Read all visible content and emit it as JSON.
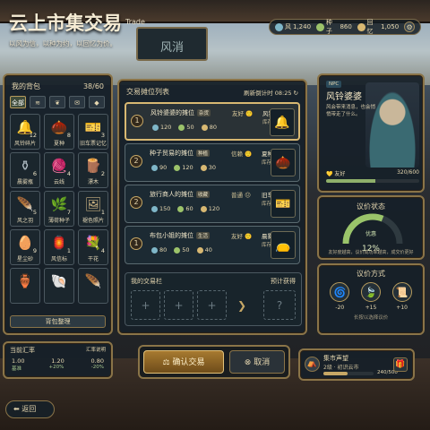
{
  "header": {
    "title": "云上市集交易",
    "title_en": "Trade",
    "subtitle": "以风为信，以种为约，以回忆为价。",
    "sign": "风消"
  },
  "resources": [
    {
      "name": "风",
      "value": "1,240",
      "color": "#7fb6c8"
    },
    {
      "name": "种子",
      "value": "860",
      "color": "#9cc36a"
    },
    {
      "name": "回忆",
      "value": "1,050",
      "color": "#d8b872"
    }
  ],
  "bag": {
    "title": "我的背包",
    "count": "38/60",
    "tabs": [
      "全部",
      "",
      "",
      "",
      ""
    ],
    "items": [
      {
        "name": "风铃碎片",
        "count": "12",
        "glyph": "🔔",
        "color": "#8fc8d0"
      },
      {
        "name": "夏种",
        "count": "8",
        "glyph": "🌰",
        "color": "#b08a5a"
      },
      {
        "name": "旧车票记忆",
        "count": "3",
        "glyph": "🎫",
        "color": "#d49a6a"
      },
      {
        "name": "晨雾瓶",
        "count": "6",
        "glyph": "⚱",
        "color": "#b0bcc4"
      },
      {
        "name": "云线",
        "count": "4",
        "glyph": "🧶",
        "color": "#c8c8c8"
      },
      {
        "name": "漂木",
        "count": "2",
        "glyph": "🪵",
        "color": "#9a7050"
      },
      {
        "name": "风之羽",
        "count": "5",
        "glyph": "🪶",
        "color": "#8ac0c8"
      },
      {
        "name": "薄荷种子",
        "count": "7",
        "glyph": "🌿",
        "color": "#7ab060"
      },
      {
        "name": "褪色照片",
        "count": "1",
        "glyph": "🖼",
        "color": "#c8b080"
      },
      {
        "name": "星尘砂",
        "count": "9",
        "glyph": "🥚",
        "color": "#d8c8a8"
      },
      {
        "name": "风信标",
        "count": "1",
        "glyph": "🏮",
        "color": "#c8a060"
      },
      {
        "name": "干花",
        "count": "4",
        "glyph": "💐",
        "color": "#b880a0"
      },
      {
        "name": "",
        "count": "",
        "glyph": "🏺",
        "color": "#c89060"
      },
      {
        "name": "",
        "count": "",
        "glyph": "🐚",
        "color": "#c8a070"
      },
      {
        "name": "",
        "count": "",
        "glyph": "🪶",
        "color": "#e0d8c8"
      }
    ],
    "sort_label": "背包整理"
  },
  "stall": {
    "title": "交易摊位列表",
    "refresh": "刷新倒计时",
    "timer": "08:25",
    "offers": [
      {
        "num": "1",
        "name": "风铃婆婆的摊位",
        "tag": "杂货",
        "mood": "友好 🙂",
        "res": [
          "120",
          "50",
          "80"
        ],
        "item": "风铃碎片",
        "stock": "库存 3",
        "glyph": "🔔"
      },
      {
        "num": "2",
        "name": "种子贸易的摊位",
        "tag": "种植",
        "mood": "信赖 🙂",
        "res": [
          "90",
          "120",
          "30"
        ],
        "item": "夏种",
        "stock": "库存 5",
        "glyph": "🌰"
      },
      {
        "num": "2",
        "name": "旅行商人的摊位",
        "tag": "收藏",
        "mood": "普通 😐",
        "res": [
          "150",
          "60",
          "120"
        ],
        "item": "旧车票记忆",
        "stock": "库存 2",
        "glyph": "🎫"
      },
      {
        "num": "1",
        "name": "布包小姐的摊位",
        "tag": "生活",
        "mood": "友好 🙂",
        "res": [
          "80",
          "50",
          "40"
        ],
        "item": "晨雾布包",
        "stock": "库存 6",
        "glyph": "👝"
      }
    ],
    "my_trade": {
      "title": "我的交易栏",
      "target": "预计获得"
    }
  },
  "npc": {
    "tag": "NPC",
    "name": "风铃婆婆",
    "desc": "风会带来消息，也会悄悄带走了什么。",
    "affection_label": "友好",
    "affection": "320/600",
    "affection_ratio": 0.53
  },
  "haggle": {
    "title": "议价状态",
    "state": "优惠",
    "pct": "12%",
    "ratio": 0.62,
    "note": "友好度越高，议价成功率越高，成交价更好"
  },
  "methods": {
    "title": "议价方式",
    "items": [
      {
        "glyph": "🌀",
        "val": "-20"
      },
      {
        "glyph": "🍃",
        "val": "+15"
      },
      {
        "glyph": "📜",
        "val": "+10"
      }
    ],
    "note": "长按以选择议价"
  },
  "rate": {
    "title": "当前汇率",
    "hint": "汇率说明",
    "values": [
      "1.00",
      "1.20",
      "0.80"
    ],
    "subs": [
      "基准",
      "+20%",
      "-20%"
    ]
  },
  "actions": {
    "confirm": "确认交易",
    "cancel": "取消"
  },
  "reputation": {
    "title": "集市声望",
    "level": "2级 · 初识云市",
    "value": "240/500",
    "ratio": 0.48
  },
  "back_label": "返回",
  "colors": {
    "wind": "#7fb6c8",
    "seed": "#9cc36a",
    "memory": "#d8b872",
    "accent": "#d8b872"
  }
}
